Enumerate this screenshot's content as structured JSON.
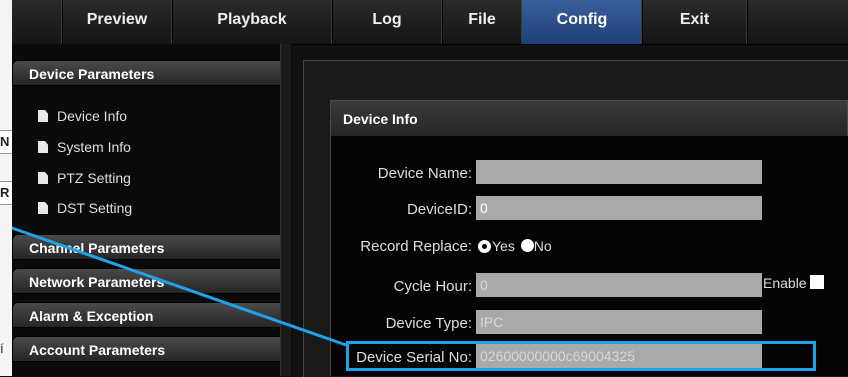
{
  "nav": {
    "items": [
      "Preview",
      "Playback",
      "Log",
      "File",
      "Config",
      "Exit"
    ],
    "active": "Config"
  },
  "left_fragments": [
    "N",
    "R",
    "í"
  ],
  "sidebar": {
    "device_parameters": "Device Parameters",
    "sub_items": [
      "Device Info",
      "System Info",
      "PTZ Setting",
      "DST Setting"
    ],
    "channel_parameters": "Channel Parameters",
    "network_parameters": "Network Parameters",
    "alarm_exception": "Alarm & Exception",
    "account_parameters": "Account Parameters"
  },
  "panel": {
    "title": "Device Info",
    "device_name_label": "Device Name:",
    "device_name_value": "",
    "device_id_label": "DeviceID:",
    "device_id_value": "0",
    "record_replace_label": "Record Replace:",
    "record_yes": "Yes",
    "record_no": "No",
    "cycle_hour_label": "Cycle Hour:",
    "cycle_hour_value": "0",
    "enable_label": "Enable",
    "device_type_label": "Device Type:",
    "device_type_value": "IPC",
    "serial_label": "Device Serial No:",
    "serial_value": "02600000000c69004325"
  },
  "colors": {
    "highlight": "#1fa3e8",
    "active_tab": "#2f5391"
  }
}
